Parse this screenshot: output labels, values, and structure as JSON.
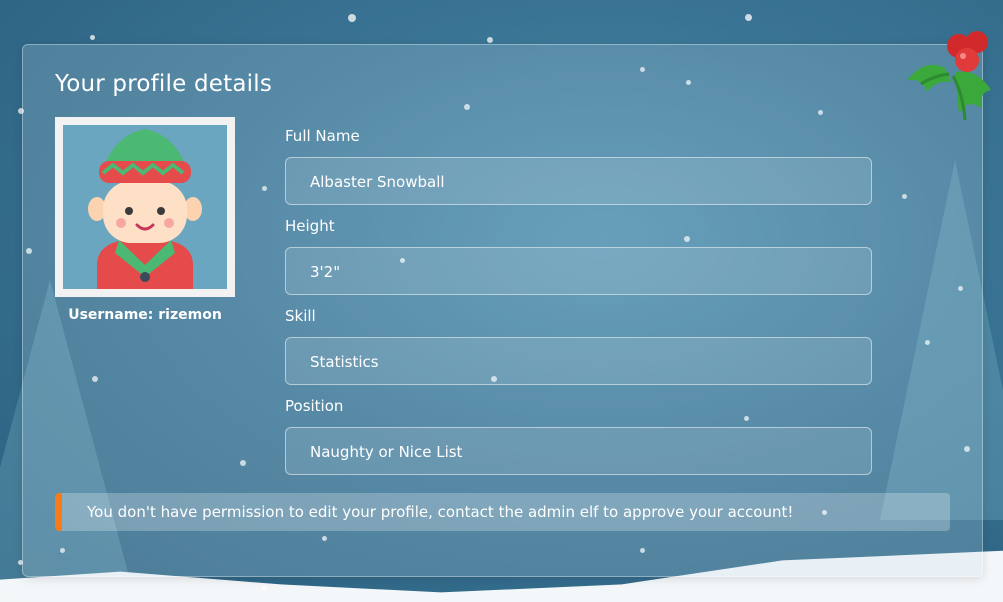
{
  "profile": {
    "heading": "Your profile details",
    "username_text": "Username: rizemon",
    "fields": [
      {
        "label": "Full Name",
        "value": "Albaster Snowball"
      },
      {
        "label": "Height",
        "value": "3'2\""
      },
      {
        "label": "Skill",
        "value": "Statistics"
      },
      {
        "label": "Position",
        "value": "Naughty or Nice List"
      }
    ],
    "notice": "You don't have permission to edit your profile, contact the admin elf to approve your account!"
  },
  "icons": {
    "avatar": "elf-avatar-icon",
    "decoration": "holly-icon"
  },
  "colors": {
    "notice_accent": "#f57c1a",
    "background": "#3a7494"
  }
}
